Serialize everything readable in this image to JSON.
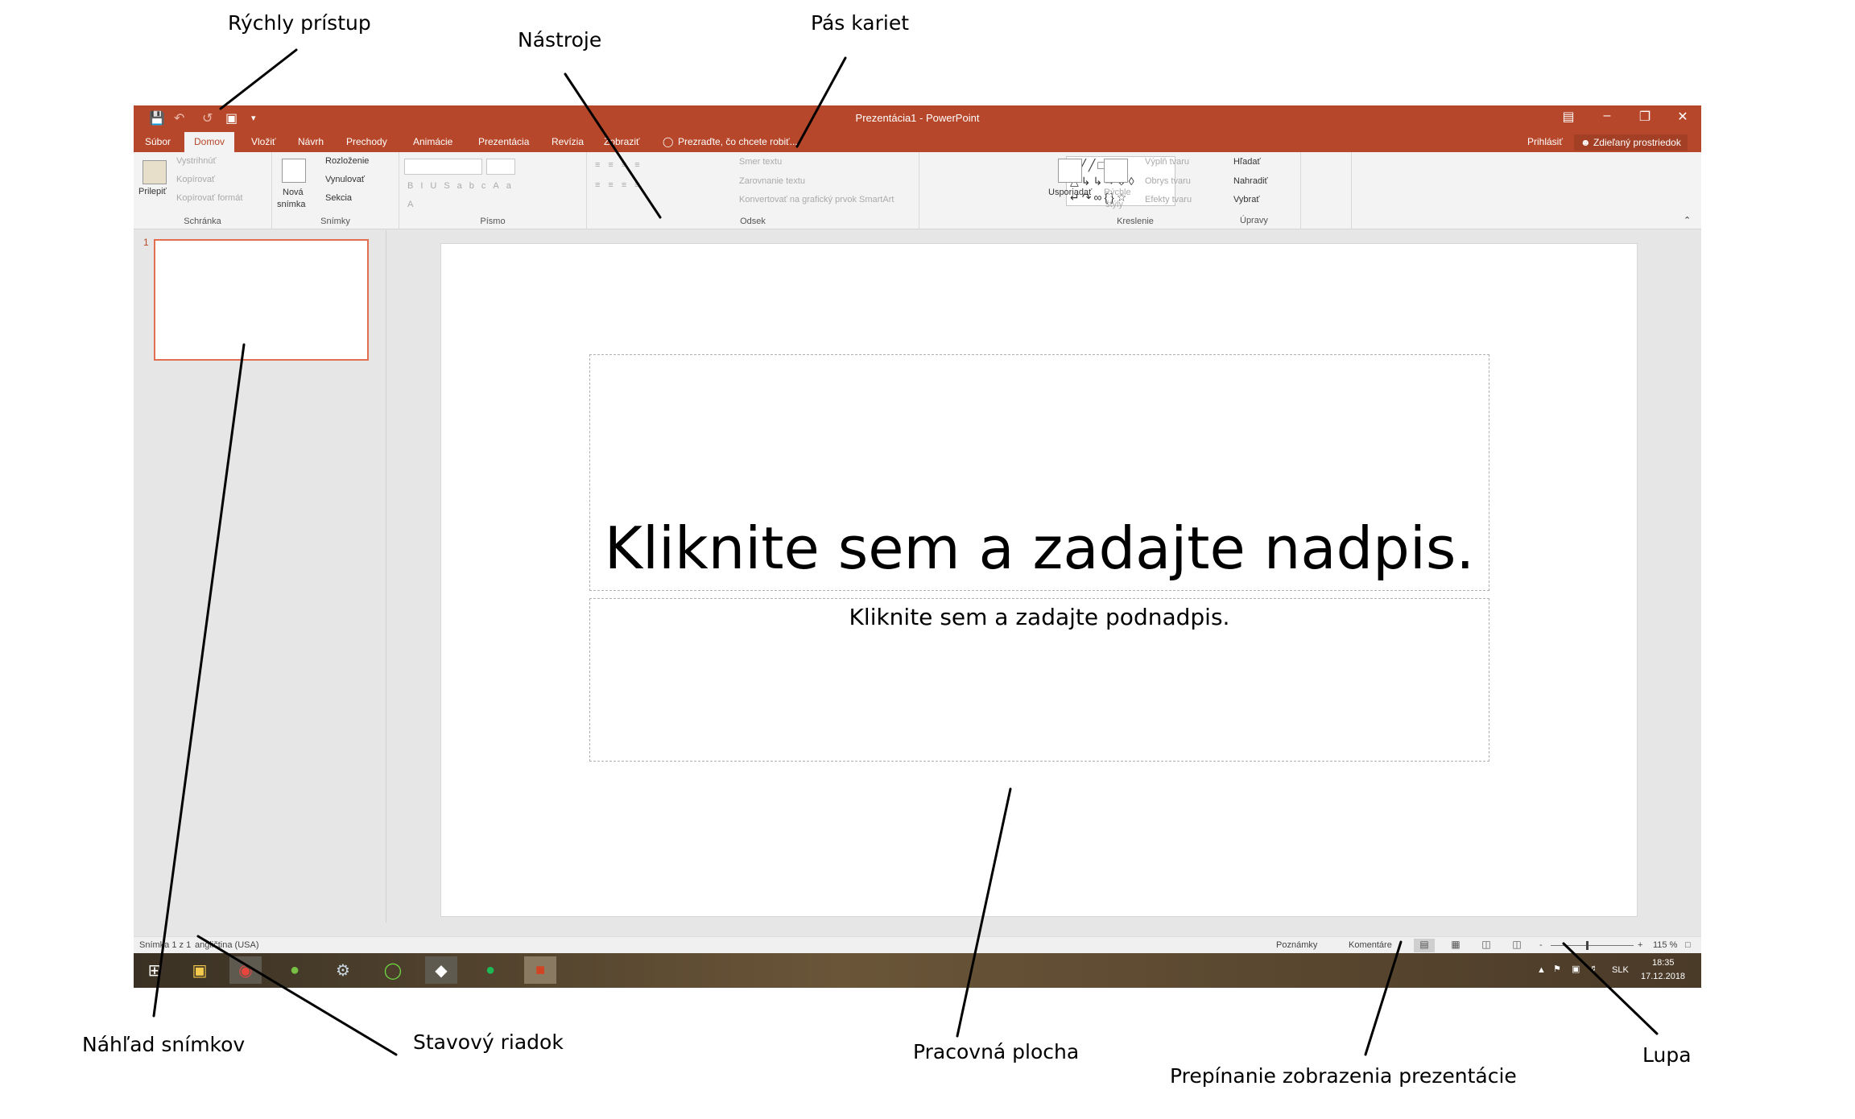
{
  "annotations": {
    "quick_access": "Rýchly prístup",
    "tools": "Nástroje",
    "ribbon": "Pás kariet",
    "thumbnails": "Náhľad snímkov",
    "status_bar": "Stavový riadok",
    "workspace": "Pracovná plocha",
    "view_switch": "Prepínanie zobrazenia prezentácie",
    "zoom": "Lupa"
  },
  "window": {
    "title": "Prezentácia1 - PowerPoint",
    "accent": "#b7472a"
  },
  "tabs": [
    {
      "label": "Súbor"
    },
    {
      "label": "Domov"
    },
    {
      "label": "Vložiť"
    },
    {
      "label": "Návrh"
    },
    {
      "label": "Prechody"
    },
    {
      "label": "Animácie"
    },
    {
      "label": "Prezentácia"
    },
    {
      "label": "Revízia"
    },
    {
      "label": "Zobraziť"
    }
  ],
  "tell_me": "Prezraďte, čo chcete robiť...",
  "sign_in": "Prihlásiť",
  "share": "Zdieľaný prostriedok",
  "ribbon": {
    "clipboard": {
      "paste": "Prilepiť",
      "cut": "Vystrihnúť",
      "copy": "Kopírovať",
      "format_painter": "Kopírovať formát",
      "label": "Schránka"
    },
    "slides": {
      "new_slide_1": "Nová",
      "new_slide_2": "snímka",
      "layout": "Rozloženie",
      "reset": "Vynulovať",
      "section": "Sekcia",
      "label": "Snímky"
    },
    "font": {
      "label": "Písmo"
    },
    "paragraph": {
      "text_direction": "Smer textu",
      "align_text": "Zarovnanie textu",
      "smartart": "Konvertovať na grafický prvok SmartArt",
      "label": "Odsek"
    },
    "drawing": {
      "arrange": "Usporiadať",
      "quick_styles_1": "Rýchle",
      "quick_styles_2": "štýly",
      "fill": "Výplň tvaru",
      "outline": "Obrys tvaru",
      "effects": "Efekty tvaru",
      "label": "Kreslenie"
    },
    "editing": {
      "find": "Hľadať",
      "replace": "Nahradiť",
      "select": "Vybrať",
      "label": "Úpravy"
    }
  },
  "thumbnail": {
    "number": "1"
  },
  "slide": {
    "title_placeholder": "Kliknite sem a zadajte nadpis.",
    "subtitle_placeholder": "Kliknite sem a zadajte podnadpis."
  },
  "status": {
    "slide_info": "Snímka 1 z 1",
    "language": "angličtina (USA)",
    "notes": "Poznámky",
    "comments": "Komentáre",
    "zoom_minus": "-",
    "zoom_plus": "+",
    "zoom": "115 %"
  },
  "taskbar": {
    "language": "SLK",
    "time": "18:35",
    "date": "17.12.2018"
  }
}
